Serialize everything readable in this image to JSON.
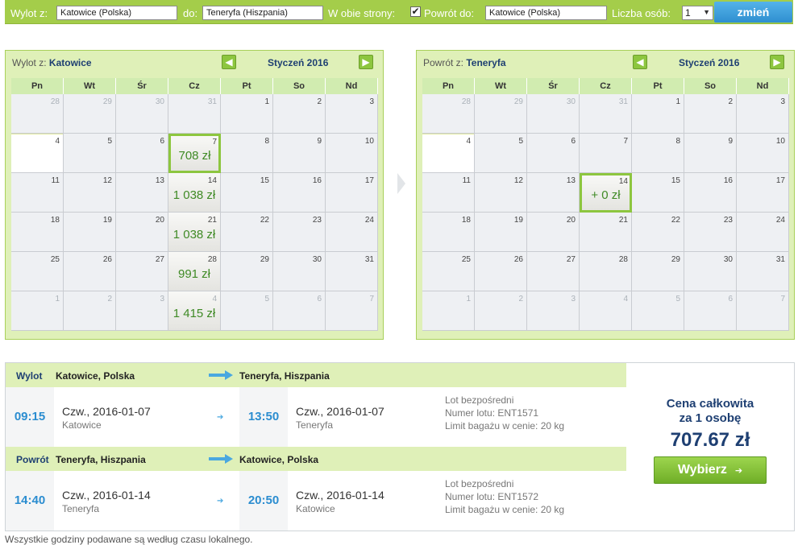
{
  "search": {
    "from_label": "Wylot z:",
    "from_value": "Katowice (Polska)",
    "to_label": "do:",
    "to_value": "Teneryfa (Hiszpania)",
    "roundtrip_label": "W obie strony:",
    "roundtrip_checked": "✔",
    "return_label": "Powrót do:",
    "return_value": "Katowice (Polska)",
    "pax_label": "Liczba osób:",
    "pax_value": "1",
    "change_label": "zmień"
  },
  "calendars": {
    "outbound": {
      "title_prefix": "Wylot z:",
      "title_city": "Katowice",
      "month": "Styczeń 2016",
      "weekdays": [
        "Pn",
        "Wt",
        "Śr",
        "Cz",
        "Pt",
        "So",
        "Nd"
      ],
      "weeks": [
        [
          {
            "d": "28",
            "o": true
          },
          {
            "d": "29",
            "o": true
          },
          {
            "d": "30",
            "o": true
          },
          {
            "d": "31",
            "o": true
          },
          {
            "d": "1"
          },
          {
            "d": "2"
          },
          {
            "d": "3"
          }
        ],
        [
          {
            "d": "4",
            "today": true
          },
          {
            "d": "5"
          },
          {
            "d": "6"
          },
          {
            "d": "7",
            "p": "708 zł",
            "sel": true
          },
          {
            "d": "8"
          },
          {
            "d": "9"
          },
          {
            "d": "10"
          }
        ],
        [
          {
            "d": "11"
          },
          {
            "d": "12"
          },
          {
            "d": "13"
          },
          {
            "d": "14",
            "p": "1 038 zł"
          },
          {
            "d": "15"
          },
          {
            "d": "16"
          },
          {
            "d": "17"
          }
        ],
        [
          {
            "d": "18"
          },
          {
            "d": "19"
          },
          {
            "d": "20"
          },
          {
            "d": "21",
            "p": "1 038 zł"
          },
          {
            "d": "22"
          },
          {
            "d": "23"
          },
          {
            "d": "24"
          }
        ],
        [
          {
            "d": "25"
          },
          {
            "d": "26"
          },
          {
            "d": "27"
          },
          {
            "d": "28",
            "p": "991 zł"
          },
          {
            "d": "29"
          },
          {
            "d": "30"
          },
          {
            "d": "31"
          }
        ],
        [
          {
            "d": "1",
            "o": true
          },
          {
            "d": "2",
            "o": true
          },
          {
            "d": "3",
            "o": true
          },
          {
            "d": "4",
            "o": true,
            "p": "1 415 zł"
          },
          {
            "d": "5",
            "o": true
          },
          {
            "d": "6",
            "o": true
          },
          {
            "d": "7",
            "o": true
          }
        ]
      ]
    },
    "return": {
      "title_prefix": "Powrót z:",
      "title_city": "Teneryfa",
      "month": "Styczeń 2016",
      "weekdays": [
        "Pn",
        "Wt",
        "Śr",
        "Cz",
        "Pt",
        "So",
        "Nd"
      ],
      "weeks": [
        [
          {
            "d": "28",
            "o": true
          },
          {
            "d": "29",
            "o": true
          },
          {
            "d": "30",
            "o": true
          },
          {
            "d": "31",
            "o": true
          },
          {
            "d": "1"
          },
          {
            "d": "2"
          },
          {
            "d": "3"
          }
        ],
        [
          {
            "d": "4",
            "today": true
          },
          {
            "d": "5"
          },
          {
            "d": "6"
          },
          {
            "d": "7"
          },
          {
            "d": "8"
          },
          {
            "d": "9"
          },
          {
            "d": "10"
          }
        ],
        [
          {
            "d": "11"
          },
          {
            "d": "12"
          },
          {
            "d": "13"
          },
          {
            "d": "14",
            "p": "+ 0 zł",
            "sel": true
          },
          {
            "d": "15"
          },
          {
            "d": "16"
          },
          {
            "d": "17"
          }
        ],
        [
          {
            "d": "18"
          },
          {
            "d": "19"
          },
          {
            "d": "20"
          },
          {
            "d": "21"
          },
          {
            "d": "22"
          },
          {
            "d": "23"
          },
          {
            "d": "24"
          }
        ],
        [
          {
            "d": "25"
          },
          {
            "d": "26"
          },
          {
            "d": "27"
          },
          {
            "d": "28"
          },
          {
            "d": "29"
          },
          {
            "d": "30"
          },
          {
            "d": "31"
          }
        ],
        [
          {
            "d": "1",
            "o": true
          },
          {
            "d": "2",
            "o": true
          },
          {
            "d": "3",
            "o": true
          },
          {
            "d": "4",
            "o": true
          },
          {
            "d": "5",
            "o": true
          },
          {
            "d": "6",
            "o": true
          },
          {
            "d": "7",
            "o": true
          }
        ]
      ]
    }
  },
  "itinerary": {
    "outbound": {
      "label": "Wylot",
      "from": "Katowice, Polska",
      "to": "Teneryfa, Hiszpania",
      "dep_time": "09:15",
      "dep_date": "Czw., 2016-01-07",
      "dep_city": "Katowice",
      "arr_time": "13:50",
      "arr_date": "Czw., 2016-01-07",
      "arr_city": "Teneryfa",
      "direct": "Lot bezpośredni",
      "flight_no": "Numer lotu: ENT1571",
      "baggage": "Limit bagażu w cenie: 20 kg"
    },
    "return": {
      "label": "Powrót",
      "from": "Teneryfa, Hiszpania",
      "to": "Katowice, Polska",
      "dep_time": "14:40",
      "dep_date": "Czw., 2016-01-14",
      "dep_city": "Teneryfa",
      "arr_time": "20:50",
      "arr_date": "Czw., 2016-01-14",
      "arr_city": "Katowice",
      "direct": "Lot bezpośredni",
      "flight_no": "Numer lotu: ENT1572",
      "baggage": "Limit bagażu w cenie: 20 kg"
    },
    "price": {
      "label_line1": "Cena całkowita",
      "label_line2": "za 1 osobę",
      "amount": "707.67 zł",
      "select_label": "Wybierz"
    }
  },
  "footnote": "Wszystkie godziny podawane są według czasu lokalnego.",
  "colors": {
    "accent_green": "#a4cd4a",
    "price_green": "#3f8a25",
    "navy": "#1e3f72",
    "time_blue": "#2b8dd0"
  }
}
